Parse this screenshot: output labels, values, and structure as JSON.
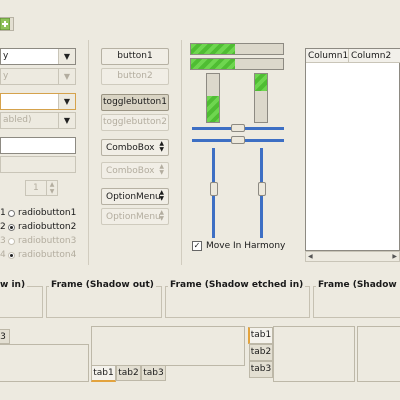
{
  "toolbar": {
    "button_icon": "add-icon"
  },
  "left": {
    "combo1": {
      "value": "y"
    },
    "combo2": {
      "value": "y"
    },
    "entry_combo1": {
      "value": ""
    },
    "entry_combo2": {
      "value": "abled)"
    },
    "entry1": {
      "value": ""
    },
    "entry2": {
      "value": ""
    },
    "spin": {
      "value": "1"
    },
    "radios": [
      {
        "label": "radiobutton1",
        "prefix": "1",
        "checked": false,
        "disabled": false
      },
      {
        "label": "radiobutton2",
        "prefix": "2",
        "checked": true,
        "disabled": false
      },
      {
        "label": "radiobutton3",
        "prefix": "3",
        "checked": false,
        "disabled": true
      },
      {
        "label": "radiobutton4",
        "prefix": "4",
        "checked": true,
        "disabled": true
      }
    ]
  },
  "buttons": {
    "button1": "button1",
    "button2": "button2",
    "toggle1": "togglebutton1",
    "toggle2": "togglebutton2",
    "combobox1": "ComboBox",
    "combobox2": "ComboBox",
    "option1": "OptionMenu",
    "option2": "OptionMenu"
  },
  "progress": {
    "h1": 0.48,
    "h2": 0.48,
    "v1": 0.55,
    "v2": 0.35
  },
  "sliders": {
    "h1": 0.5,
    "h2": 0.5,
    "v1": 0.45,
    "v2": 0.45
  },
  "harmony": {
    "label": "Move In Harmony",
    "checked": true
  },
  "tree": {
    "col1": "Column1",
    "col2": "Column2"
  },
  "frames": {
    "f0": "w in)",
    "f1": "Frame (Shadow out)",
    "f2": "Frame (Shadow etched in)",
    "f3": "Frame (Shadow etched o"
  },
  "tabs": {
    "left_tab": "3",
    "bottom": [
      "tab1",
      "tab2",
      "tab3"
    ],
    "side": [
      "tab1",
      "tab2",
      "tab3"
    ]
  }
}
